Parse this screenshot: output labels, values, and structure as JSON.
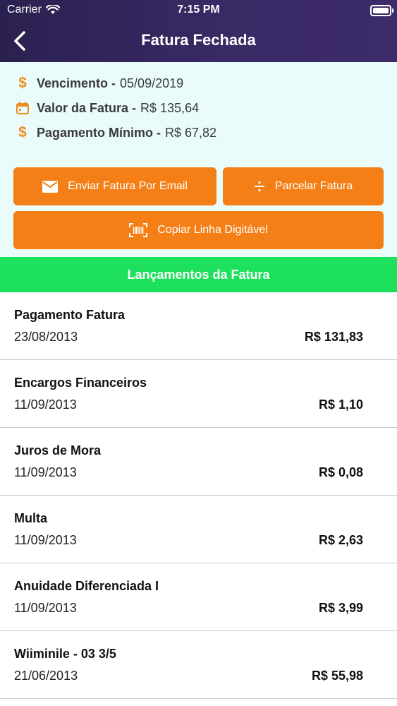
{
  "status_bar": {
    "carrier": "Carrier",
    "time": "7:15 PM"
  },
  "header": {
    "title": "Fatura Fechada"
  },
  "summary": {
    "vencimento": {
      "label": "Vencimento -",
      "value": "05/09/2019",
      "icon": "dollar-icon"
    },
    "valor": {
      "label": "Valor da Fatura -",
      "value": "R$ 135,64",
      "icon": "calendar-icon"
    },
    "minimo": {
      "label": "Pagamento Mínimo -",
      "value": "R$ 67,82",
      "icon": "dollar-icon"
    }
  },
  "actions": {
    "email": "Enviar Fatura Por Email",
    "parcelar": "Parcelar Fatura",
    "copiar": "Copiar Linha Digitável"
  },
  "section": {
    "title": "Lançamentos da Fatura"
  },
  "items": [
    {
      "description": "Pagamento Fatura",
      "date": "23/08/2013",
      "amount": "R$ 131,83"
    },
    {
      "description": "Encargos Financeiros",
      "date": "11/09/2013",
      "amount": "R$ 1,10"
    },
    {
      "description": "Juros de Mora",
      "date": "11/09/2013",
      "amount": "R$ 0,08"
    },
    {
      "description": "Multa",
      "date": "11/09/2013",
      "amount": "R$ 2,63"
    },
    {
      "description": "Anuidade Diferenciada I",
      "date": "11/09/2013",
      "amount": "R$ 3,99"
    },
    {
      "description": "Wiiminile - 03 3/5",
      "date": "21/06/2013",
      "amount": "R$ 55,98"
    }
  ],
  "colors": {
    "header": "#3a2a66",
    "summary_bg": "#eafbfb",
    "accent_orange": "#f47f17",
    "section_green": "#1de15c"
  }
}
